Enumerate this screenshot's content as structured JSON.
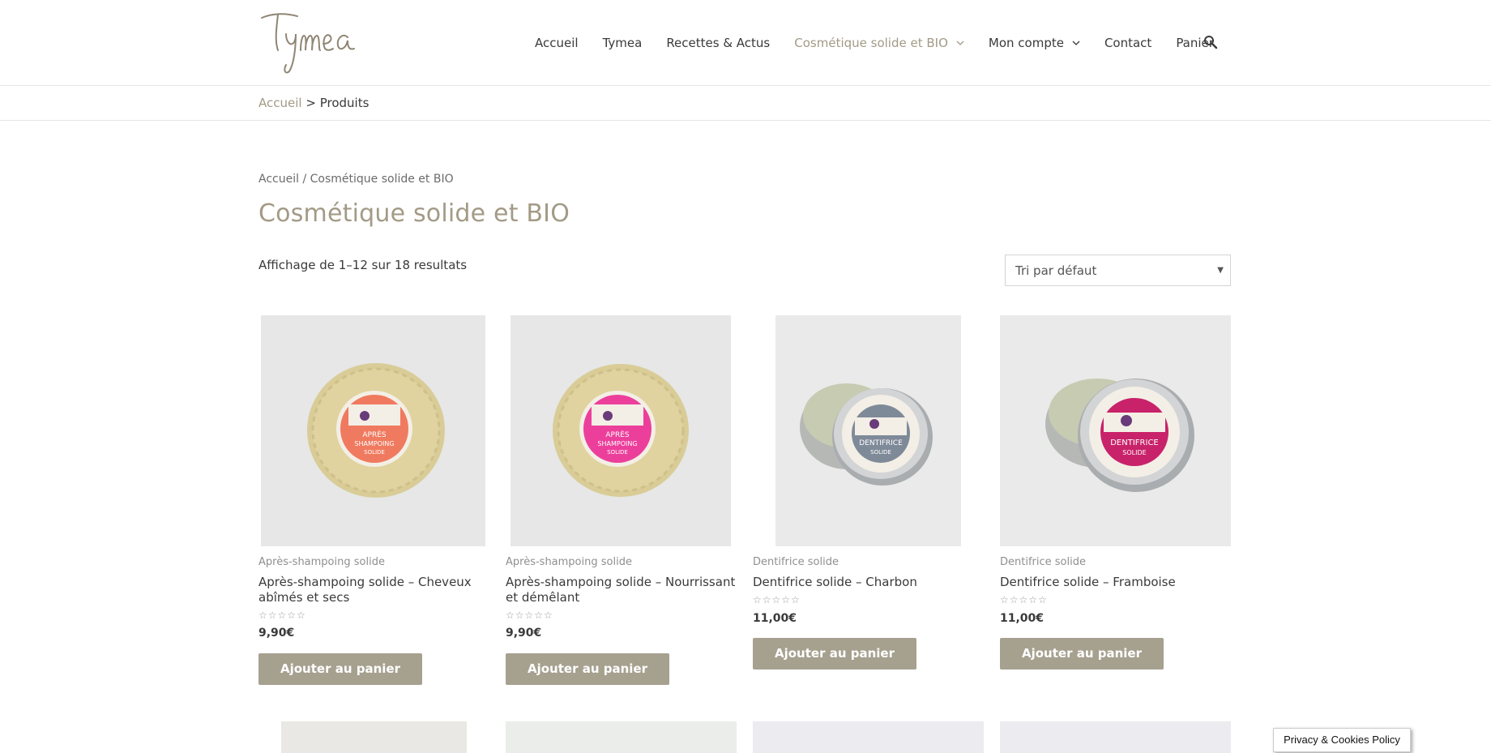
{
  "brand": {
    "logo_text": "Tymea",
    "accent_color": "#a39a86",
    "button_color": "#a6a08f"
  },
  "nav": {
    "items": [
      {
        "label": "Accueil",
        "active": false,
        "dropdown": false
      },
      {
        "label": "Tymea",
        "active": false,
        "dropdown": false
      },
      {
        "label": "Recettes & Actus",
        "active": false,
        "dropdown": false
      },
      {
        "label": "Cosmétique solide et BIO",
        "active": true,
        "dropdown": true
      },
      {
        "label": "Mon compte",
        "active": false,
        "dropdown": true
      },
      {
        "label": "Contact",
        "active": false,
        "dropdown": false
      },
      {
        "label": "Panier",
        "active": false,
        "dropdown": false
      }
    ],
    "search_icon": "search-icon"
  },
  "top_breadcrumb": {
    "home": "Accueil",
    "separator": ">",
    "current": "Produits"
  },
  "shop_breadcrumb": {
    "home": "Accueil",
    "separator": "/",
    "current": "Cosmétique solide et BIO"
  },
  "page_title": "Cosmétique solide et BIO",
  "results_text": "Affichage de 1–12 sur 18 resultats",
  "sort": {
    "selected": "Tri par défaut"
  },
  "products": [
    {
      "category": "Après-shampoing solide",
      "name": "Après-shampoing solide – Cheveux abîmés et secs",
      "rating_stars": "☆☆☆☆☆",
      "price": "9,90€",
      "button": "Ajouter au panier",
      "label_color": "#f07a5f",
      "product_type": "soap"
    },
    {
      "category": "Après-shampoing solide",
      "name": "Après-shampoing solide – Nourrissant et démêlant",
      "rating_stars": "☆☆☆☆☆",
      "price": "9,90€",
      "button": "Ajouter au panier",
      "label_color": "#ec3f9b",
      "product_type": "soap"
    },
    {
      "category": "Dentifrice solide",
      "name": "Dentifrice solide – Charbon",
      "rating_stars": "☆☆☆☆☆",
      "price": "11,00€",
      "button": "Ajouter au panier",
      "label_color": "#7f8a99",
      "product_type": "tin"
    },
    {
      "category": "Dentifrice solide",
      "name": "Dentifrice solide – Framboise",
      "rating_stars": "☆☆☆☆☆",
      "price": "11,00€",
      "button": "Ajouter au panier",
      "label_color": "#c8226a",
      "product_type": "tin"
    }
  ],
  "cookie_notice": "Privacy & Cookies Policy"
}
